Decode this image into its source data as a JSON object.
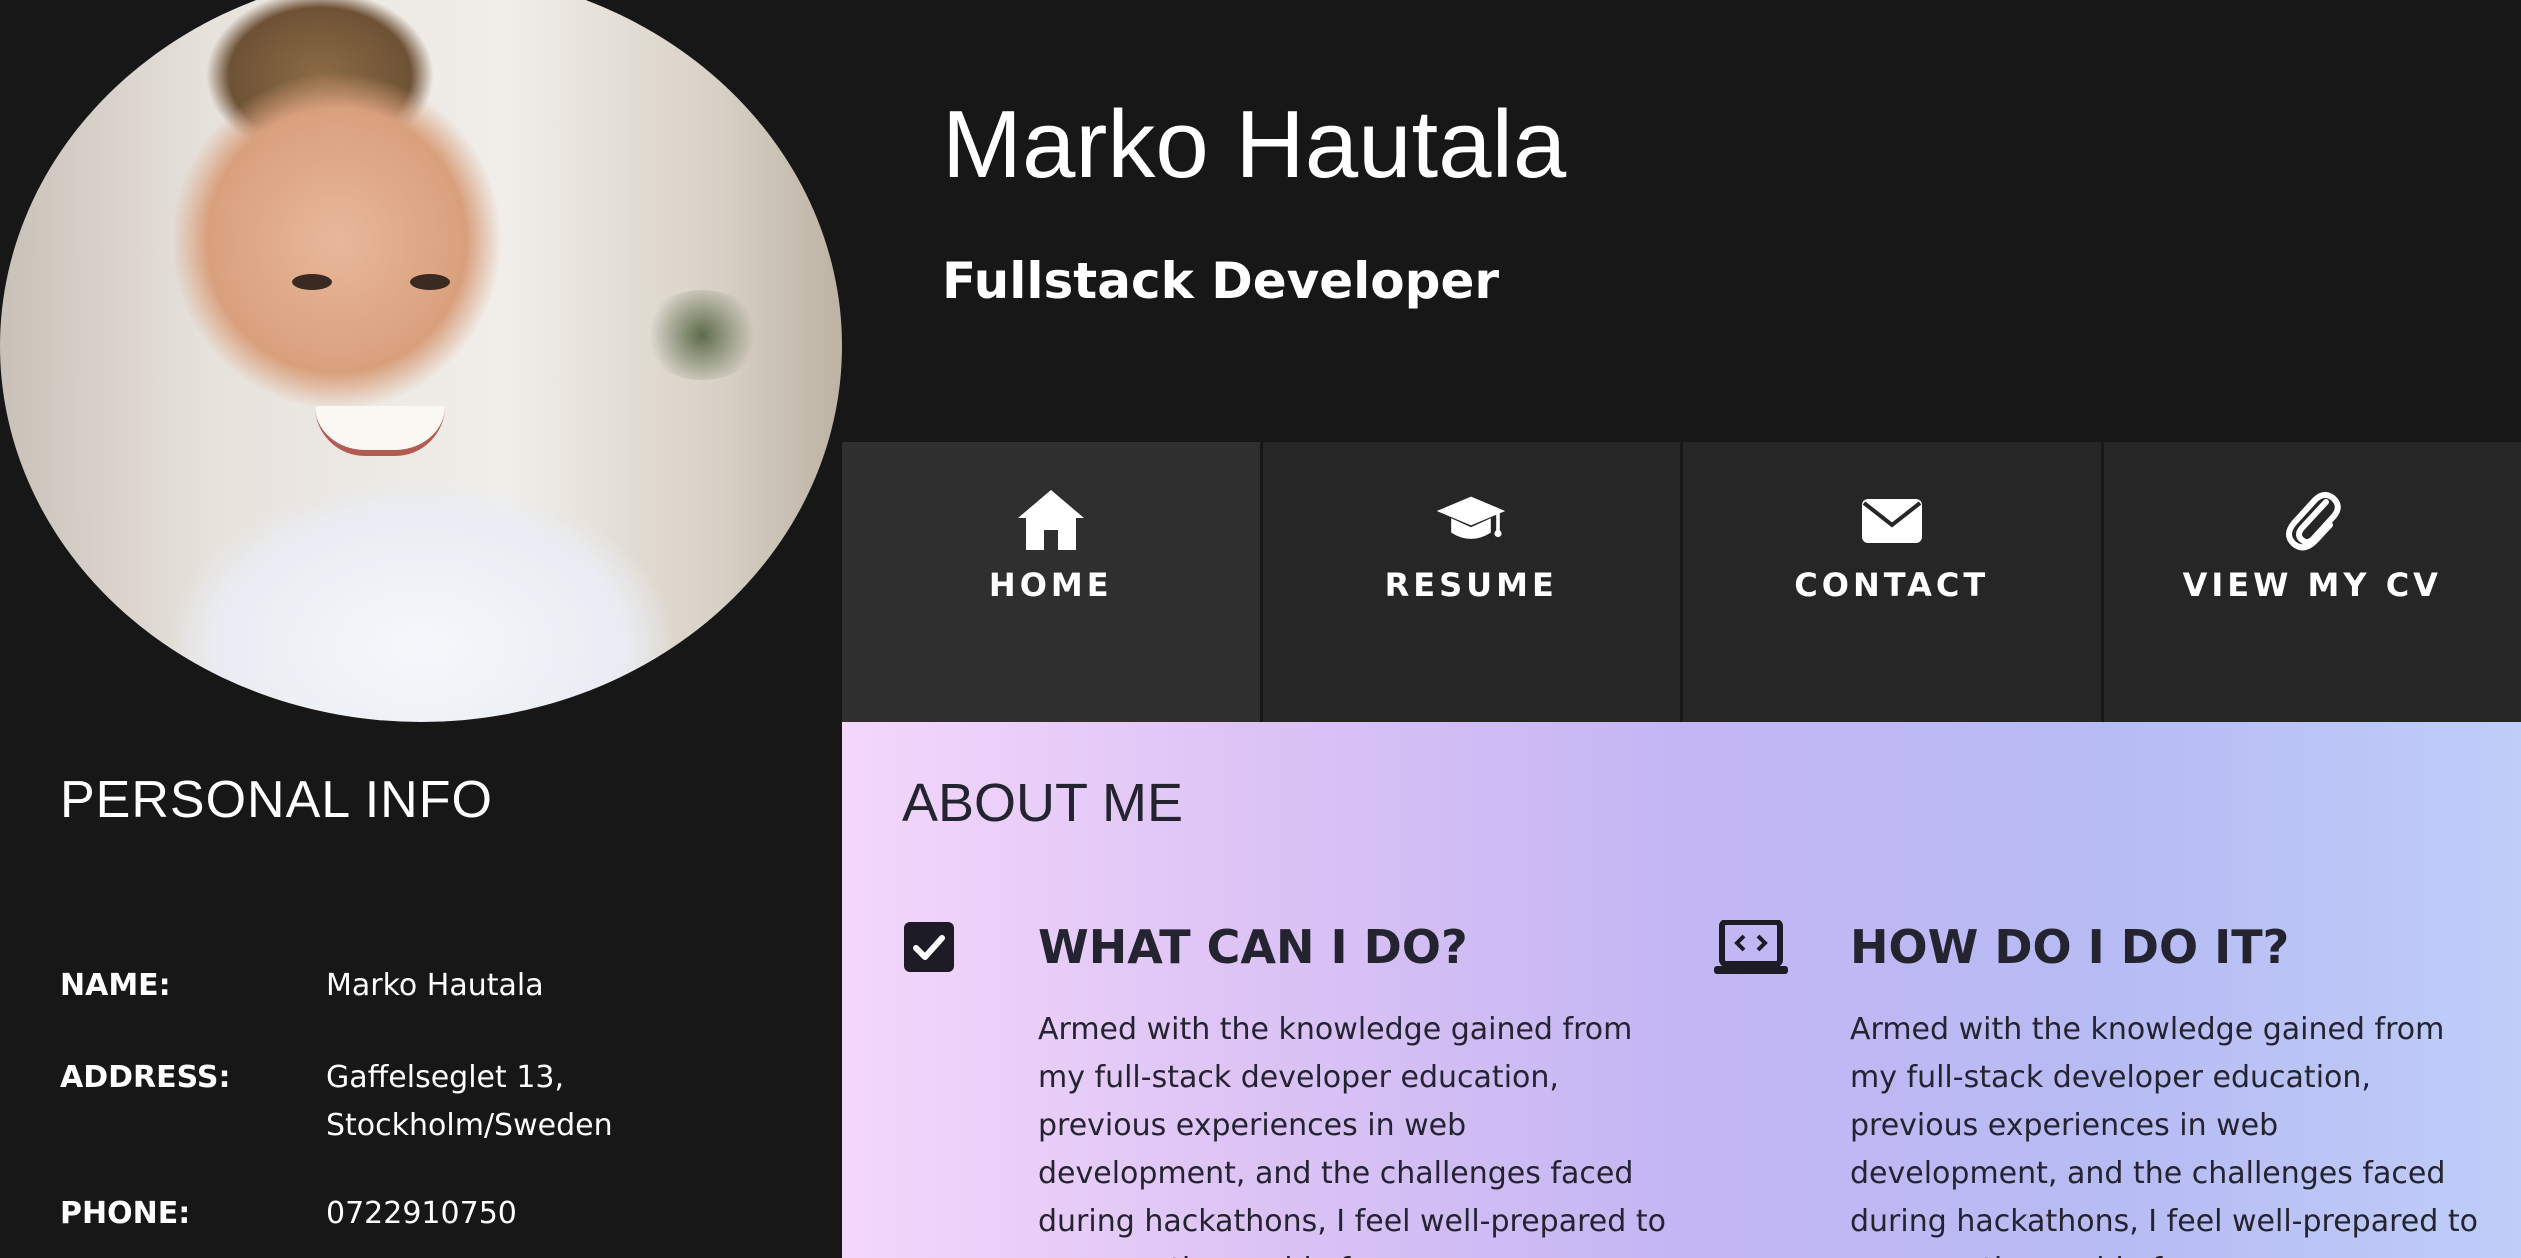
{
  "profile": {
    "name": "Marko Hautala",
    "role": "Fullstack Developer"
  },
  "personal_info": {
    "title": "PERSONAL INFO",
    "rows": [
      {
        "label": "NAME:",
        "value": "Marko Hautala"
      },
      {
        "label": "ADDRESS:",
        "value": "Gaffelseglet 13,\nStockholm/Sweden"
      },
      {
        "label": "PHONE:",
        "value": "0722910750"
      }
    ]
  },
  "nav": {
    "items": [
      {
        "label": "HOME",
        "icon": "home-icon",
        "active": true
      },
      {
        "label": "RESUME",
        "icon": "graduation-cap-icon",
        "active": false
      },
      {
        "label": "CONTACT",
        "icon": "envelope-icon",
        "active": false
      },
      {
        "label": "VIEW MY CV",
        "icon": "paperclip-icon",
        "active": false
      }
    ]
  },
  "about": {
    "title": "ABOUT ME",
    "columns": [
      {
        "icon": "checkbox-icon",
        "title": "WHAT CAN I DO?",
        "text": "Armed with the knowledge gained from my full-stack developer education, previous experiences in web development, and the challenges faced during hackathons, I feel well-prepared to conquer the world of"
      },
      {
        "icon": "laptop-code-icon",
        "title": "HOW DO I DO IT?",
        "text": "Armed with the knowledge gained from my full-stack developer education, previous experiences in web development, and the challenges faced during hackathons, I feel well-prepared to conquer the world of"
      }
    ]
  },
  "colors": {
    "background": "#171717",
    "nav_background": "#262626",
    "nav_active": "#2f2f2f",
    "about_gradient": [
      "#f4d7fb",
      "#c3b6f4",
      "#bfcdf8"
    ],
    "about_text": "#242330"
  }
}
